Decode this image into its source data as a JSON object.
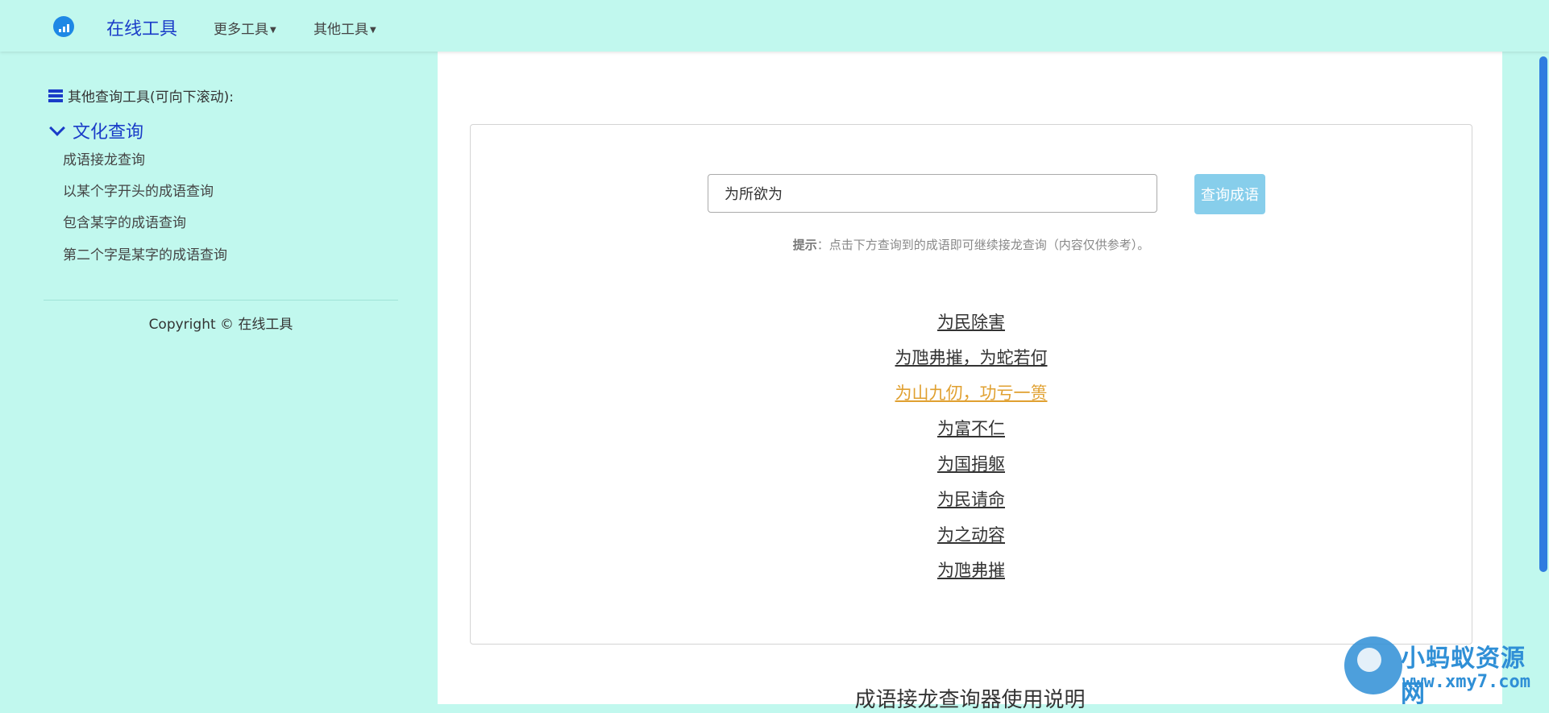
{
  "navbar": {
    "brand": "在线工具",
    "menus": [
      {
        "label": "更多工具"
      },
      {
        "label": "其他工具"
      }
    ]
  },
  "sidebar": {
    "header": "其他查询工具(可向下滚动):",
    "category": "文化查询",
    "links": [
      "成语接龙查询",
      "以某个字开头的成语查询",
      "包含某字的成语查询",
      "第二个字是某字的成语查询"
    ],
    "copyright": "Copyright © 在线工具"
  },
  "search": {
    "value": "为所欲为",
    "button": "查询成语"
  },
  "hint": {
    "label": "提示",
    "text": "：点击下方查询到的成语即可继续接龙查询（内容仅供参考）。"
  },
  "results": [
    "为民除害",
    "为虺弗摧，为蛇若何",
    "为山九仞，功亏一篑",
    "为富不仁",
    "为国捐躯",
    "为民请命",
    "为之动容",
    "为虺弗摧"
  ],
  "active_result_index": 2,
  "section_title": "成语接龙查询器使用说明",
  "watermark": {
    "line1": "小蚂蚁资源网",
    "line2": "www.xmy7.com"
  },
  "colors": {
    "background": "#c1f8ee",
    "brand": "#1a3cc8",
    "button": "#87ceeb",
    "active_link": "#e0a030"
  }
}
